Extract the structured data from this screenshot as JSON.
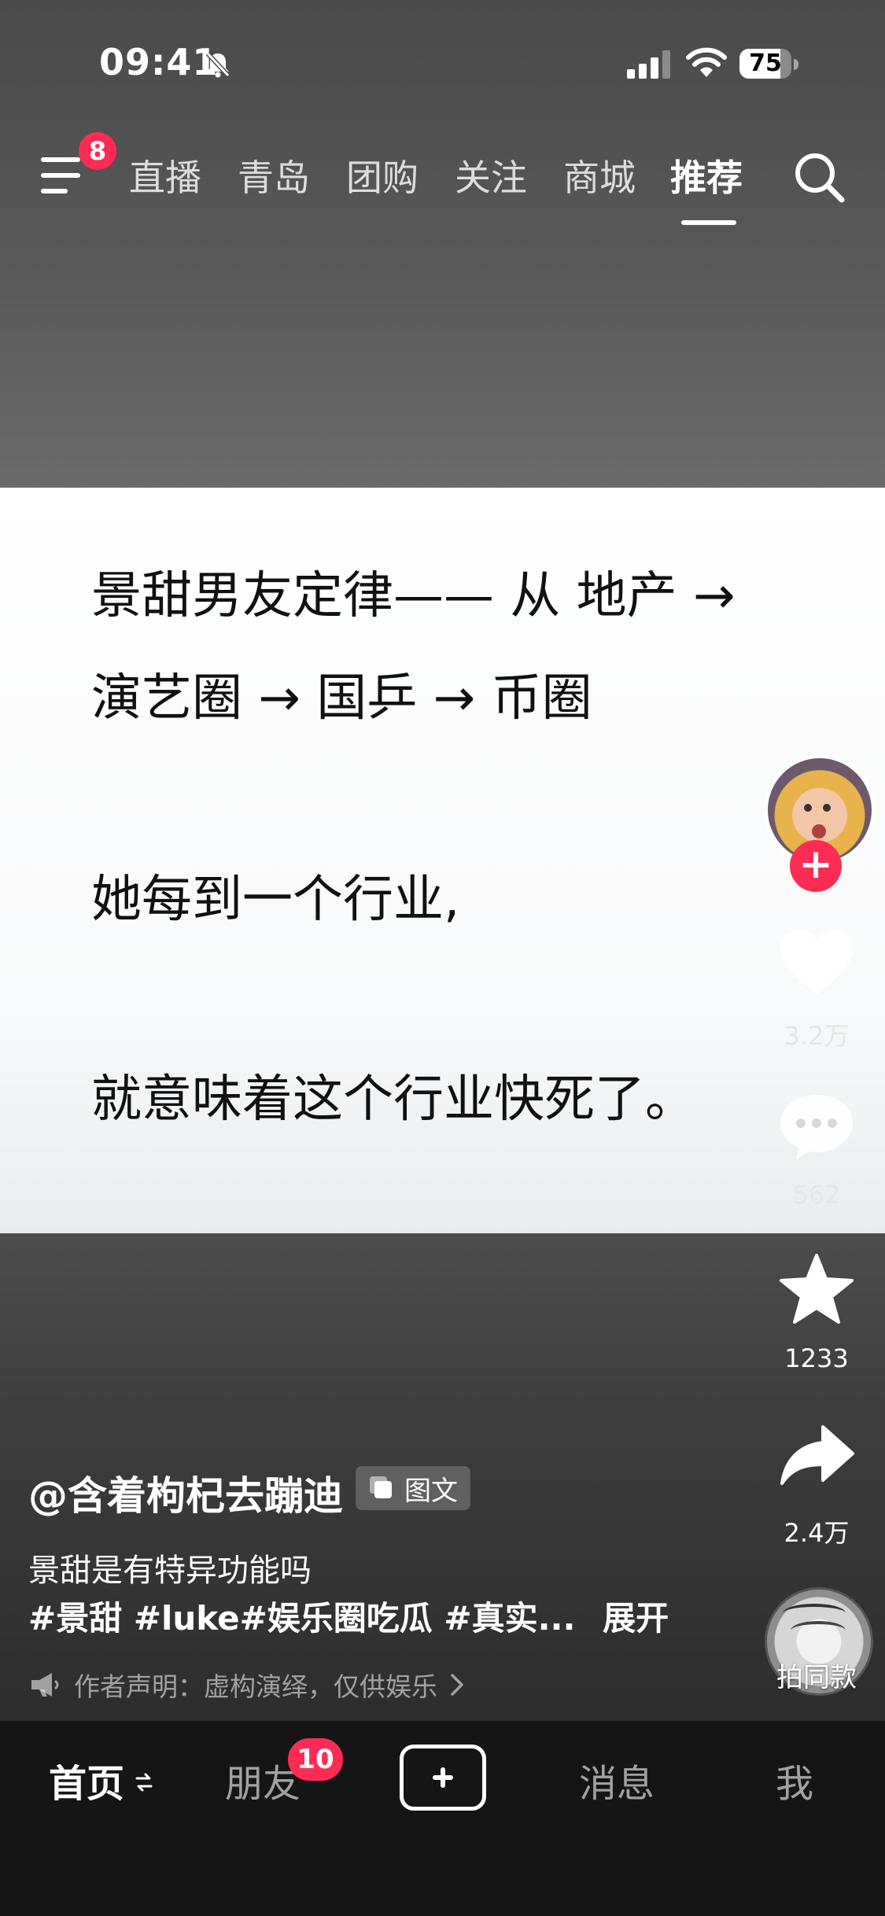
{
  "status_bar": {
    "time": "09:41",
    "battery": "75"
  },
  "top_nav": {
    "menu_badge": "8",
    "tabs": [
      "直播",
      "青岛",
      "团购",
      "关注",
      "商城",
      "推荐"
    ],
    "active_tab": "推荐"
  },
  "post": {
    "lines": [
      "景甜男友定律—— 从 地产 →",
      "演艺圈 → 国乒 → 币圈",
      "她每到一个行业,",
      "就意味着这个行业快死了。"
    ]
  },
  "actions": {
    "likes": "3.2万",
    "comments": "562",
    "favorites": "1233",
    "shares": "2.4万",
    "same_style": "拍同款"
  },
  "author": {
    "name": "@含着枸杞去蹦迪",
    "post_type": "图文",
    "caption": "景甜是有特异功能吗",
    "hashtags": "#景甜 #luke#娱乐圈吃瓜 #真实...",
    "expand": "展开",
    "disclaimer": "作者声明：虚构演绎，仅供娱乐"
  },
  "bottom_nav": {
    "home": "首页",
    "friends": "朋友",
    "friends_badge": "10",
    "messages": "消息",
    "me": "我"
  },
  "colors": {
    "accent": "#fe2c55",
    "nav_bg": "#151515"
  }
}
